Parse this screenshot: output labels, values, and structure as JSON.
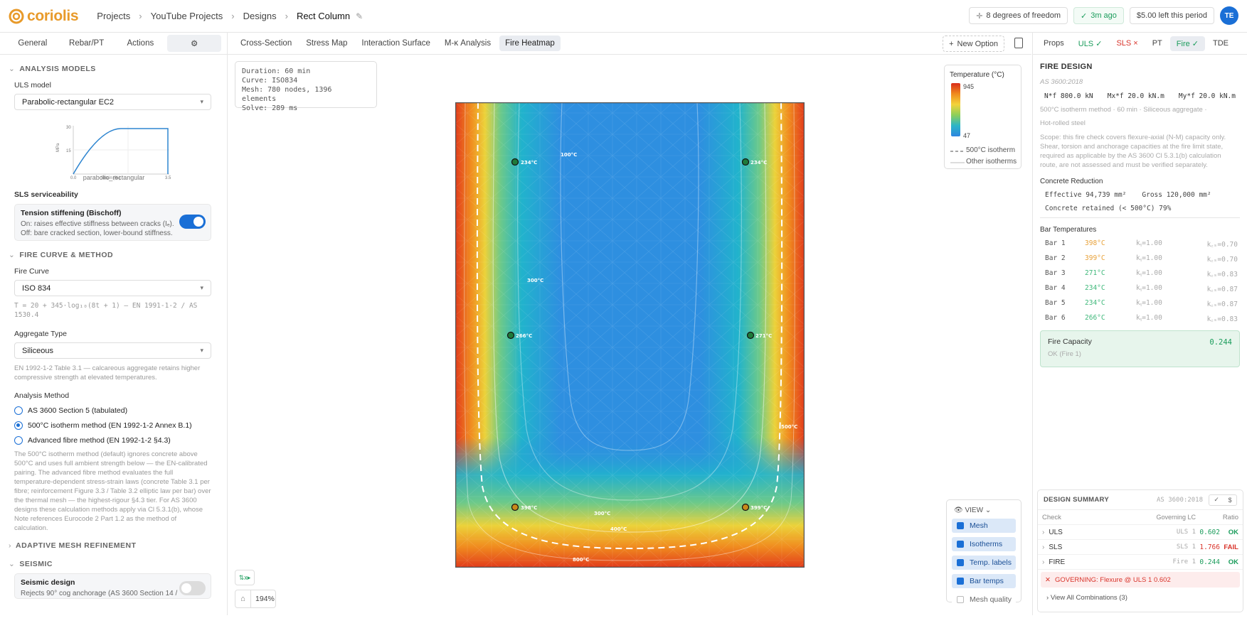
{
  "app": {
    "brand": "coriolis"
  },
  "breadcrumb": [
    "Projects",
    "YouTube Projects",
    "Designs",
    "Rect Column"
  ],
  "topbar": {
    "dof": "8 degrees of freedom",
    "saved": "3m ago",
    "credit": "$5.00 left this period",
    "avatar": "TE"
  },
  "left": {
    "tabs": [
      "General",
      "Rebar/PT",
      "Actions"
    ],
    "analysis_models": "ANALYSIS MODELS",
    "uls_label": "ULS model",
    "uls_value": "Parabolic-rectangular EC2",
    "curve_caption": "parabolic_rectangular",
    "curve_axis": {
      "y_top": "30",
      "y_mid": "15",
      "x0": "0.0",
      "x_end": "3.5",
      "xlabel": "Strain (‰)",
      "ylabel": "MPa"
    },
    "sls_label": "SLS serviceability",
    "tension_title": "Tension stiffening (Bischoff)",
    "tension_on": "On: raises effective stiffness between cracks (Iₑ).",
    "tension_off": "Off: bare cracked section, lower-bound stiffness.",
    "fire_curve_header": "FIRE CURVE & METHOD",
    "fire_curve_label": "Fire Curve",
    "fire_curve_value": "ISO 834",
    "fire_formula": "T = 20 + 345·log₁₀(8t + 1) — EN 1991-1-2 / AS 1530.4",
    "aggregate_label": "Aggregate Type",
    "aggregate_value": "Siliceous",
    "aggregate_note": "EN 1992-1-2 Table 3.1 — calcareous aggregate retains higher compressive strength at elevated temperatures.",
    "method_label": "Analysis Method",
    "methods": [
      "AS 3600 Section 5 (tabulated)",
      "500°C isotherm method (EN 1992-1-2 Annex B.1)",
      "Advanced fibre method (EN 1992-1-2 §4.3)"
    ],
    "method_note": "The 500°C isotherm method (default) ignores concrete above 500°C and uses full ambient strength below — the EN-calibrated pairing. The advanced fibre method evaluates the full temperature-dependent stress-strain laws (concrete Table 3.1 per fibre; reinforcement Figure 3.3 / Table 3.2 elliptic law per bar) over the thermal mesh — the highest-rigour §4.3 tier. For AS 3600 designs these calculation methods apply via Cl 5.3.1(b), whose Note references Eurocode 2 Part 1.2 as the method of calculation.",
    "adaptive_header": "ADAPTIVE MESH REFINEMENT",
    "seismic_header": "SEISMIC",
    "seismic_title": "Seismic design",
    "seismic_desc": "Rejects 90° cog anchorage (AS 3600 Section 14 /"
  },
  "center": {
    "tabs": [
      "Cross-Section",
      "Stress Map",
      "Interaction Surface",
      "M-κ Analysis",
      "Fire Heatmap"
    ],
    "new_option": "New Option",
    "info": [
      "Duration: 60 min",
      "Curve: ISO834",
      "Mesh: 780 nodes, 1396 elements",
      "Solve: 289 ms"
    ],
    "legend_title": "Temperature (°C)",
    "legend_max": "945",
    "legend_min": "47",
    "legend_iso": "500°C isotherm",
    "legend_other": "Other isotherms",
    "view_title": "VIEW",
    "view_items": [
      "Mesh",
      "Isotherms",
      "Temp. labels",
      "Bar temps",
      "Mesh quality"
    ],
    "axes_label": "x",
    "zoom": "194%",
    "bar_labels": [
      "234°C",
      "234°C",
      "266°C",
      "271°C",
      "398°C",
      "399°C"
    ],
    "iso_labels": [
      "100°C",
      "300°C",
      "500°C",
      "300°C",
      "400°C",
      "800°C"
    ]
  },
  "right": {
    "tabs": [
      "Props",
      "ULS",
      "SLS",
      "PT",
      "Fire",
      "TDE"
    ],
    "title": "FIRE DESIGN",
    "standard": "AS 3600:2018",
    "loads": [
      "N*f 800.0 kN",
      "Mx*f 20.0 kN.m",
      "My*f 20.0 kN.m"
    ],
    "meta1": "500°C isotherm method · 60 min · Siliceous aggregate ·",
    "meta2": "Hot-rolled steel",
    "scope": "Scope: this fire check covers flexure-axial (N-M) capacity only. Shear, torsion and anchorage capacities at the fire limit state, required as applicable by the AS 3600 Cl 5.3.1(b) calculation route, are not assessed and must be verified separately.",
    "concrete_header": "Concrete Reduction",
    "effective": "Effective 94,739 mm²",
    "gross": "Gross 120,000 mm²",
    "retained": "Concrete retained (< 500°C) 79%",
    "bar_header": "Bar Temperatures",
    "bars": [
      {
        "name": "Bar 1",
        "temp": "398°C",
        "ky": "kᵧ=1.00",
        "kz": "k꜀ₛ=0.70",
        "color": "#e8a23a"
      },
      {
        "name": "Bar 2",
        "temp": "399°C",
        "ky": "kᵧ=1.00",
        "kz": "k꜀ₛ=0.70",
        "color": "#e8a23a"
      },
      {
        "name": "Bar 3",
        "temp": "271°C",
        "ky": "kᵧ=1.00",
        "kz": "k꜀ₛ=0.83",
        "color": "#3fb87a"
      },
      {
        "name": "Bar 4",
        "temp": "234°C",
        "ky": "kᵧ=1.00",
        "kz": "k꜀ₛ=0.87",
        "color": "#3fb87a"
      },
      {
        "name": "Bar 5",
        "temp": "234°C",
        "ky": "kᵧ=1.00",
        "kz": "k꜀ₛ=0.87",
        "color": "#3fb87a"
      },
      {
        "name": "Bar 6",
        "temp": "266°C",
        "ky": "kᵧ=1.00",
        "kz": "k꜀ₛ=0.83",
        "color": "#3fb87a"
      }
    ],
    "capacity_title": "Fire Capacity",
    "capacity_status": "OK (Fire 1)",
    "capacity_value": "0.244",
    "summary_title": "DESIGN SUMMARY",
    "summary_std": "AS 3600:2018",
    "summary_cols": [
      "Check",
      "Governing LC",
      "Ratio"
    ],
    "summary_rows": [
      {
        "check": "ULS",
        "lc": "ULS 1",
        "ratio": "0.602",
        "status": "OK",
        "color": "#1a9c5b"
      },
      {
        "check": "SLS",
        "lc": "SLS 1",
        "ratio": "1.766",
        "status": "FAIL",
        "color": "#d9342b"
      },
      {
        "check": "FIRE",
        "lc": "Fire 1",
        "ratio": "0.244",
        "status": "OK",
        "color": "#1a9c5b"
      }
    ],
    "governing": "GOVERNING: Flexure @ ULS 1 0.602",
    "view_all": "View All Combinations (3)"
  }
}
